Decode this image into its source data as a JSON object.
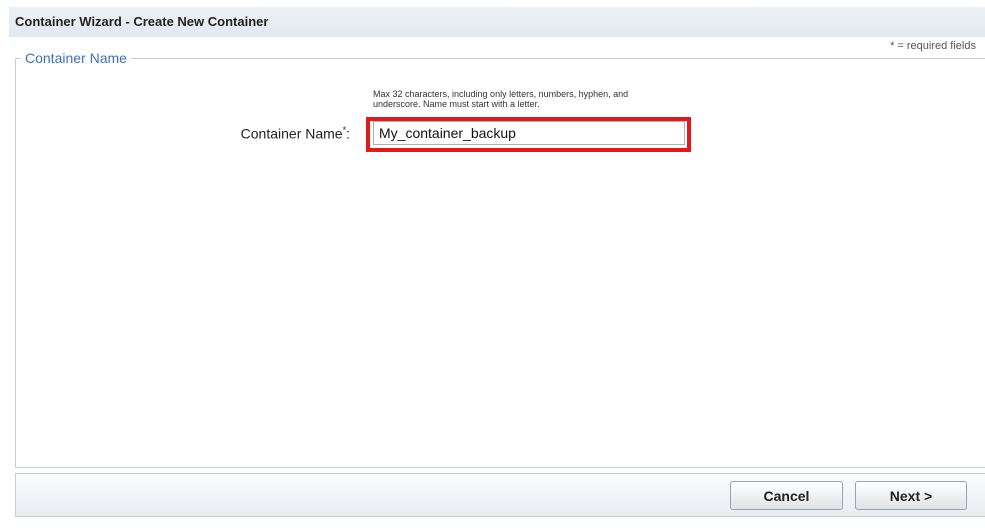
{
  "window": {
    "title": "Container Wizard - Create New Container"
  },
  "form": {
    "required_note": "* = required fields",
    "section_legend": "Container Name",
    "hint_line1": "Max 32 characters, including only letters, numbers, hyphen, and",
    "hint_line2": "underscore. Name must start with a letter.",
    "field_label": "Container Name",
    "required_marker": "*",
    "label_colon": ":",
    "field_value": "My_container_backup",
    "highlight_color": "#e11919"
  },
  "footer": {
    "cancel_label": "Cancel",
    "next_label": "Next >"
  }
}
